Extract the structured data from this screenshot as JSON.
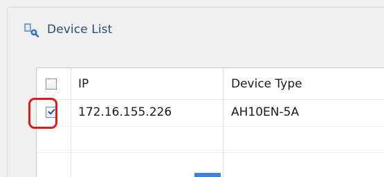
{
  "panel": {
    "title": "Device List",
    "icon": "device-list-icon"
  },
  "table": {
    "columns": [
      {
        "name": "select",
        "label": ""
      },
      {
        "name": "ip",
        "label": "IP"
      },
      {
        "name": "device_type",
        "label": "Device Type"
      }
    ],
    "header_checkbox_checked": false,
    "rows": [
      {
        "selected": true,
        "ip": "172.16.155.226",
        "device_type": "AH10EN-5A"
      }
    ]
  },
  "annotation": {
    "highlight_color": "#e01919",
    "target": "row-select-checkbox"
  },
  "colors": {
    "title_text": "#2c4c6d",
    "accent_bar": "#3f82d8"
  }
}
